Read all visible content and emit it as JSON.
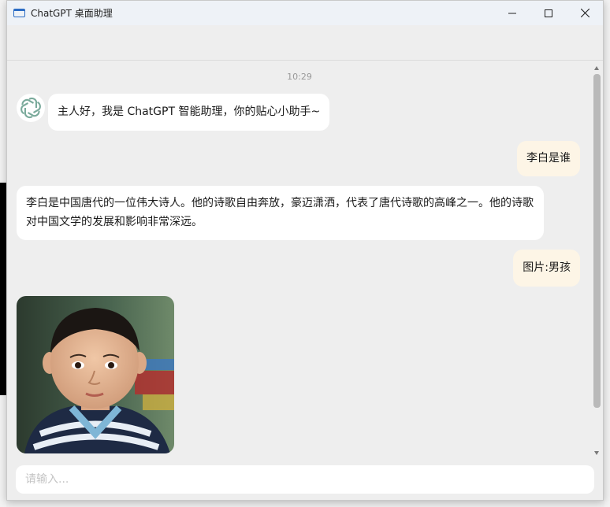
{
  "window": {
    "title": "ChatGPT 桌面助理"
  },
  "chat": {
    "timestamp": "10:29",
    "messages": [
      {
        "role": "bot",
        "text": "主人好，我是 ChatGPT 智能助理，你的贴心小助手~"
      },
      {
        "role": "user",
        "text": "李白是谁"
      },
      {
        "role": "bot",
        "text": "李白是中国唐代的一位伟大诗人。他的诗歌自由奔放，豪迈潇洒，代表了唐代诗歌的高峰之一。他的诗歌对中国文学的发展和影响非常深远。"
      },
      {
        "role": "user",
        "text": "图片:男孩"
      },
      {
        "role": "bot",
        "image": "boy-photo"
      }
    ]
  },
  "input": {
    "placeholder": "请输入...",
    "value": ""
  },
  "colors": {
    "user_bubble": "#fdf5e6",
    "bot_bubble": "#ffffff",
    "background": "#eeeeee"
  },
  "icons": {
    "app": "window-icon",
    "bot_avatar": "openai-logo-icon",
    "minimize": "minimize-icon",
    "maximize": "maximize-icon",
    "close": "close-icon"
  }
}
